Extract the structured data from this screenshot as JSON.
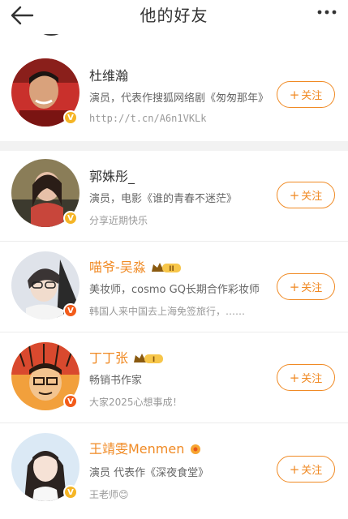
{
  "header": {
    "title": "他的好友"
  },
  "icons": {
    "back": "arrow-left-icon",
    "more": "more-dots-icon",
    "verified": "verified-v-icon",
    "crown": "vip-crown-icon"
  },
  "colors": {
    "accent": "#f08a24",
    "verified_gold": "#f5b526",
    "verified_red": "#f25b1a",
    "divider": "#f2f2f2"
  },
  "friends": [
    {
      "name": "杜维瀚",
      "desc": "演员，代表作搜狐网络剧《匆匆那年》",
      "sub": "http://t.cn/A6n1VKLk",
      "follow_label": "关注",
      "verified": "gold"
    },
    {
      "name": "郭姝彤_",
      "desc": "演员，电影《谁的青春不迷茫》",
      "sub": "分享近期快乐",
      "follow_label": "关注",
      "verified": "gold"
    },
    {
      "name": "喵爷-吴淼",
      "crown_level": "II",
      "desc": "美妆师，cosmo GQ长期合作彩妆师",
      "sub": "韩国人来中国去上海免签旅行，……",
      "follow_label": "关注",
      "verified": "red"
    },
    {
      "name": "丁丁张",
      "crown_level": "I",
      "desc": "畅销书作家",
      "sub": "大家2025心想事成！",
      "follow_label": "关注",
      "verified": "red"
    },
    {
      "name": "王靖雯Menmen",
      "desc": "演员 代表作《深夜食堂》",
      "sub": "王老师😊",
      "follow_label": "关注",
      "verified": "gold"
    }
  ]
}
